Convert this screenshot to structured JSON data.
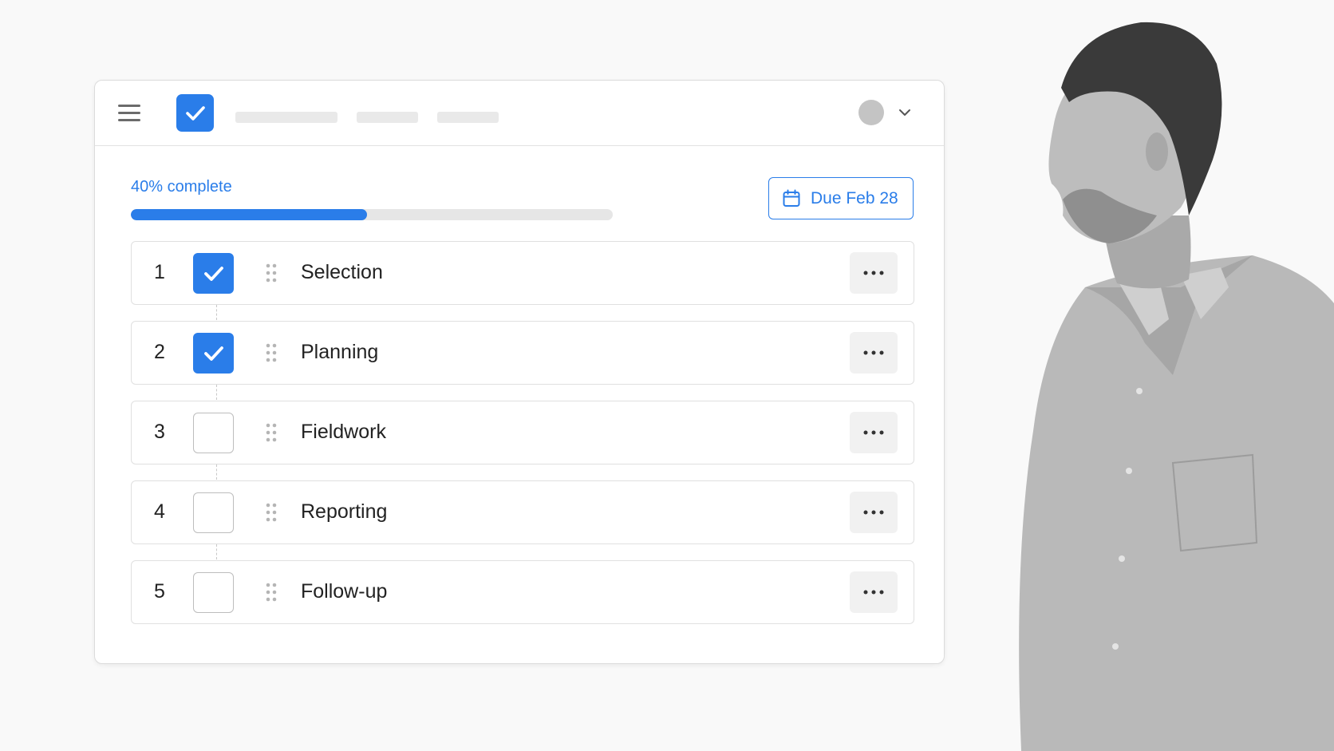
{
  "header": {
    "menu_icon": "hamburger-menu-icon",
    "logo_icon": "checkbox-check-icon",
    "avatar_icon": "avatar",
    "dropdown_icon": "chevron-down-icon"
  },
  "progress": {
    "label": "40% complete",
    "fraction": 0.49
  },
  "due": {
    "label": "Due Feb 28",
    "icon": "calendar-icon"
  },
  "steps": [
    {
      "number": "1",
      "label": "Selection",
      "checked": true
    },
    {
      "number": "2",
      "label": "Planning",
      "checked": true
    },
    {
      "number": "3",
      "label": "Fieldwork",
      "checked": false
    },
    {
      "number": "4",
      "label": "Reporting",
      "checked": false
    },
    {
      "number": "5",
      "label": "Follow-up",
      "checked": false
    }
  ],
  "colors": {
    "accent": "#2a7de9",
    "border": "#e0e0e0",
    "background": "#f9f9f9"
  }
}
